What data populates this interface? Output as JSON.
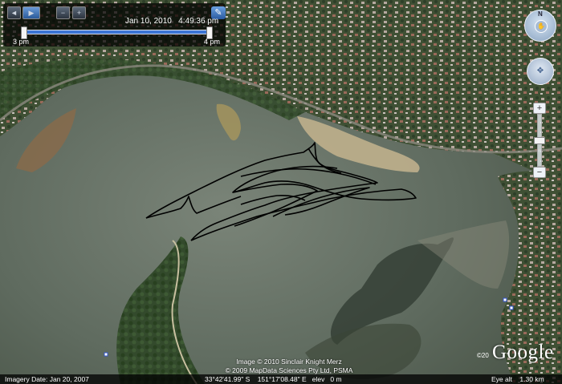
{
  "time_slider": {
    "datetime": "Jan 10, 2010   4:49:36 pm",
    "start_label": "3 pm",
    "end_label": "4 pm",
    "position": 1.0,
    "buttons": [
      "step-back-icon",
      "play-icon",
      "zoom-out-time-icon",
      "zoom-in-time-icon",
      "wrench-icon"
    ]
  },
  "navigation": {
    "compass_north": "N",
    "icons": [
      "compass-icon",
      "look-icon",
      "zoom-in-icon",
      "zoom-out-icon"
    ]
  },
  "attribution": {
    "line1": "Image © 2010 Sinclair Knight Merz",
    "line2": "© 2009 MapData Sciences Pty Ltd, PSMA"
  },
  "status_bar": {
    "imagery_date": "Imagery Date: Jan 20, 2007",
    "coordinates": "33°42'41.99\" S    151°17'08.48\" E   elev   0 m",
    "eye_alt": "Eye alt    1.30 km"
  },
  "logo": {
    "text": "Google",
    "copyright": "©20"
  },
  "colors": {
    "water": "#5c6a5c",
    "track": "#000000",
    "slider_fill": "#3b74d4",
    "panel": "#000000"
  }
}
